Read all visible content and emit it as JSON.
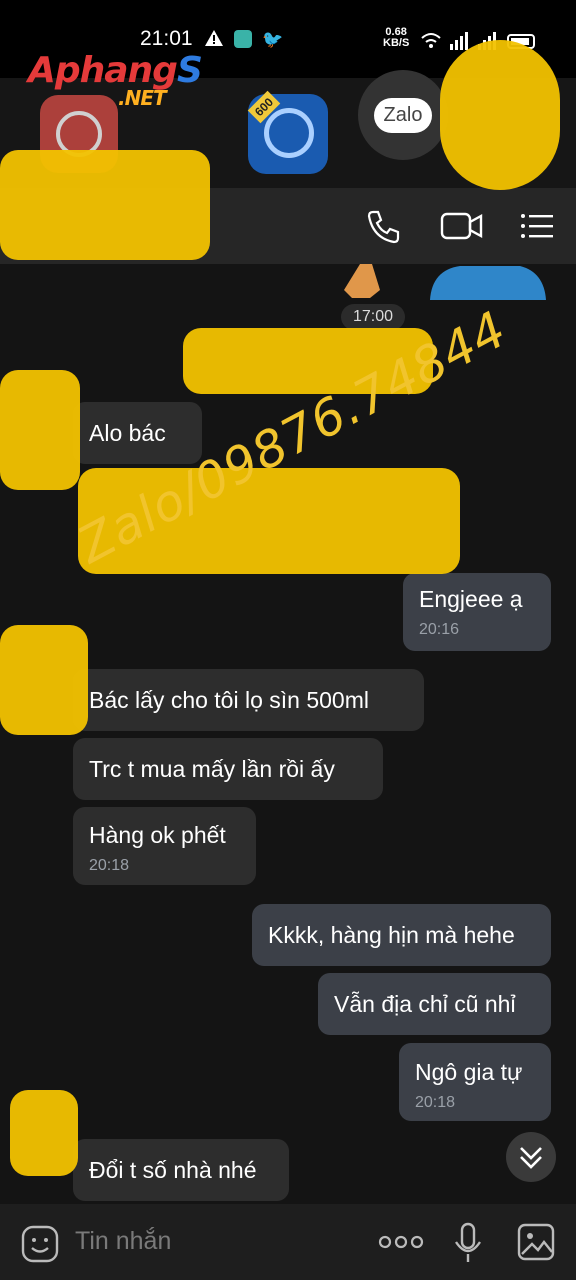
{
  "status_bar": {
    "time": "21:01",
    "network_speed_value": "0.68",
    "network_speed_unit": "KB/S",
    "icons": [
      "warning-icon",
      "app-notification-icon",
      "twitter-icon",
      "wifi-icon",
      "signal-icon",
      "signal-icon",
      "battery-icon"
    ]
  },
  "watermark_logo": {
    "main_part1": "Aphang",
    "main_part2": "S",
    "suffix": ".NET"
  },
  "app_dock": {
    "zalo_label": "Zalo",
    "badge_number": "600"
  },
  "chat_header": {
    "actions": [
      {
        "name": "call-button",
        "icon": "phone-icon"
      },
      {
        "name": "video-call-button",
        "icon": "video-camera-icon"
      },
      {
        "name": "menu-button",
        "icon": "list-menu-icon"
      }
    ]
  },
  "messages": [
    {
      "type": "time-chip",
      "text": "17:00"
    },
    {
      "type": "in",
      "text": "Alo bác",
      "time": ""
    },
    {
      "type": "out",
      "text": "Engjeee ạ",
      "time": "20:16"
    },
    {
      "type": "in",
      "text": "Bác lấy cho tôi lọ sìn 500ml",
      "time": ""
    },
    {
      "type": "in",
      "text": "Trc t mua mấy lần rồi ấy",
      "time": ""
    },
    {
      "type": "in",
      "text": "Hàng ok phết",
      "time": "20:18"
    },
    {
      "type": "out",
      "text": "Kkkk, hàng hịn mà hehe",
      "time": ""
    },
    {
      "type": "out",
      "text": "Vẫn địa chỉ cũ nhỉ",
      "time": ""
    },
    {
      "type": "out",
      "text": "Ngô gia tự",
      "time": "20:18"
    },
    {
      "type": "in",
      "text": "Đổi t số nhà nhé",
      "time": ""
    }
  ],
  "overlay_watermark": "Zalo/09876.74844",
  "composer": {
    "placeholder": "Tin nhắn"
  },
  "colors": {
    "background": "#141414",
    "incoming_bubble": "#2d2d2d",
    "outgoing_bubble": "#3c4048",
    "highlight_yellow": "#f2c200"
  }
}
